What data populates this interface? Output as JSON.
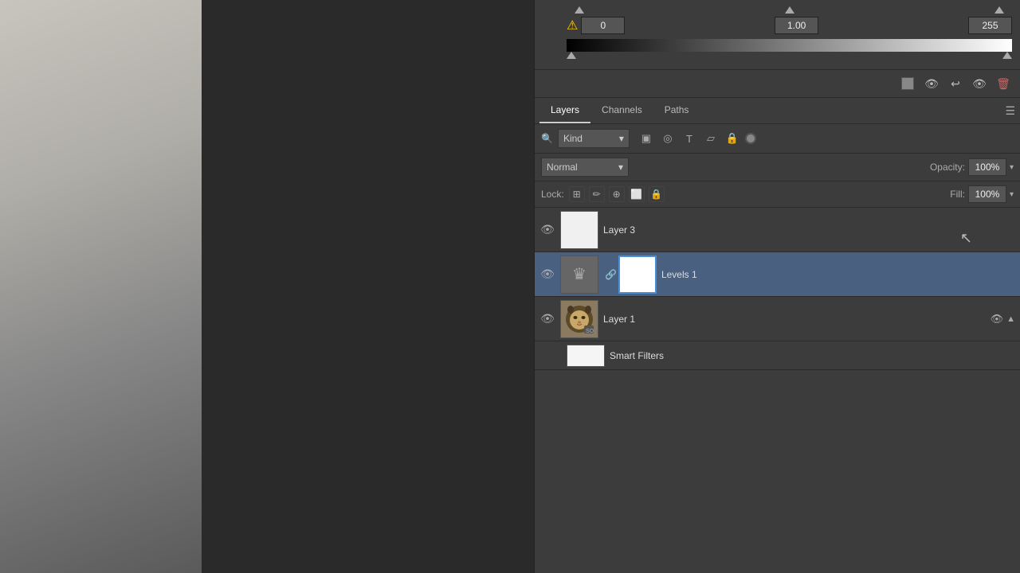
{
  "canvas": {
    "bg_color": "#aaa8a0",
    "dark_color": "#2a2a2a"
  },
  "levels": {
    "input_black": "0",
    "input_mid": "1.00",
    "input_white": "255"
  },
  "toolbar": {
    "icons": [
      "◼",
      "👁",
      "↩",
      "👁",
      "🗑"
    ]
  },
  "tabs": {
    "layers_label": "Layers",
    "channels_label": "Channels",
    "paths_label": "Paths",
    "active": "layers"
  },
  "filter": {
    "kind_label": "Kind",
    "search_placeholder": "Kind"
  },
  "blend": {
    "mode_label": "Normal",
    "opacity_label": "Opacity:",
    "opacity_value": "100%"
  },
  "lock": {
    "label": "Lock:",
    "icons": [
      "⊞",
      "✏",
      "⊕",
      "⬜",
      "🔒"
    ],
    "fill_label": "Fill:",
    "fill_value": "100%"
  },
  "layers": [
    {
      "id": "layer3",
      "name": "Layer 3",
      "visible": true,
      "selected": false,
      "thumb_type": "white",
      "has_mask": false,
      "has_adj_icon": false
    },
    {
      "id": "levels1",
      "name": "Levels 1",
      "visible": true,
      "selected": true,
      "thumb_type": "adj",
      "has_mask": true,
      "has_adj_icon": true
    },
    {
      "id": "layer1",
      "name": "Layer 1",
      "visible": true,
      "selected": false,
      "thumb_type": "lion",
      "has_mask": false,
      "has_adj_icon": false,
      "has_smart_icon": true
    },
    {
      "id": "smart-filters",
      "name": "Smart Filters",
      "visible": false,
      "selected": false,
      "thumb_type": "smart",
      "is_smart_filters": true
    }
  ],
  "cursor": {
    "visible": true
  }
}
